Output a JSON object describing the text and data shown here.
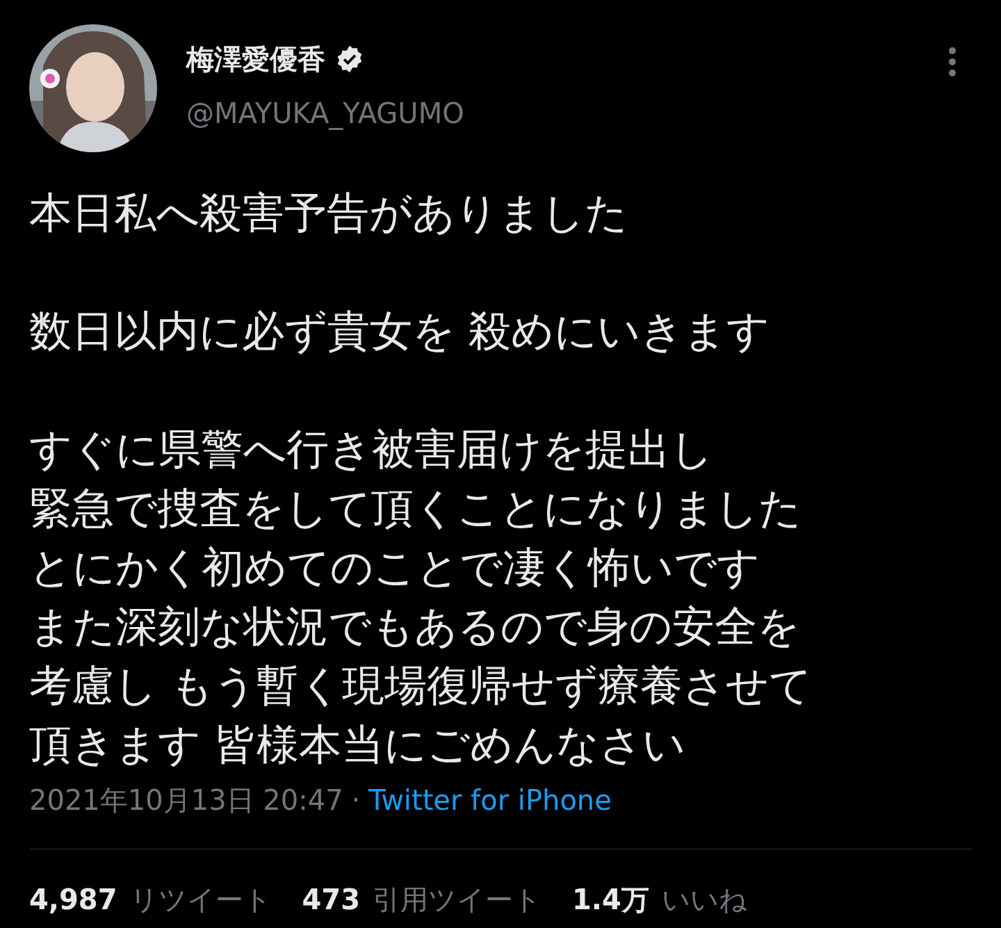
{
  "author": {
    "name": "梅澤愛優香",
    "verified": true,
    "handle": "@MAYUKA_YAGUMO"
  },
  "body": [
    [
      "本日私へ殺害予告がありました"
    ],
    [
      "数日以内に必ず貴女を 殺めにいきます"
    ],
    [
      "すぐに県警へ行き被害届けを提出し",
      "緊急で捜査をして頂くことになりました",
      "とにかく初めてのことで凄く怖いです",
      "また深刻な状況でもあるので身の安全を",
      "考慮し もう暫く現場復帰せず療養させて",
      "頂きます  皆様本当にごめんなさい"
    ]
  ],
  "timestamp": "2021年10月13日 20:47",
  "separator": "·",
  "source": "Twitter for iPhone",
  "stats": [
    {
      "count": "4,987",
      "label": "リツイート"
    },
    {
      "count": "473",
      "label": "引用ツイート"
    },
    {
      "count": "1.4万",
      "label": "いいね"
    }
  ]
}
